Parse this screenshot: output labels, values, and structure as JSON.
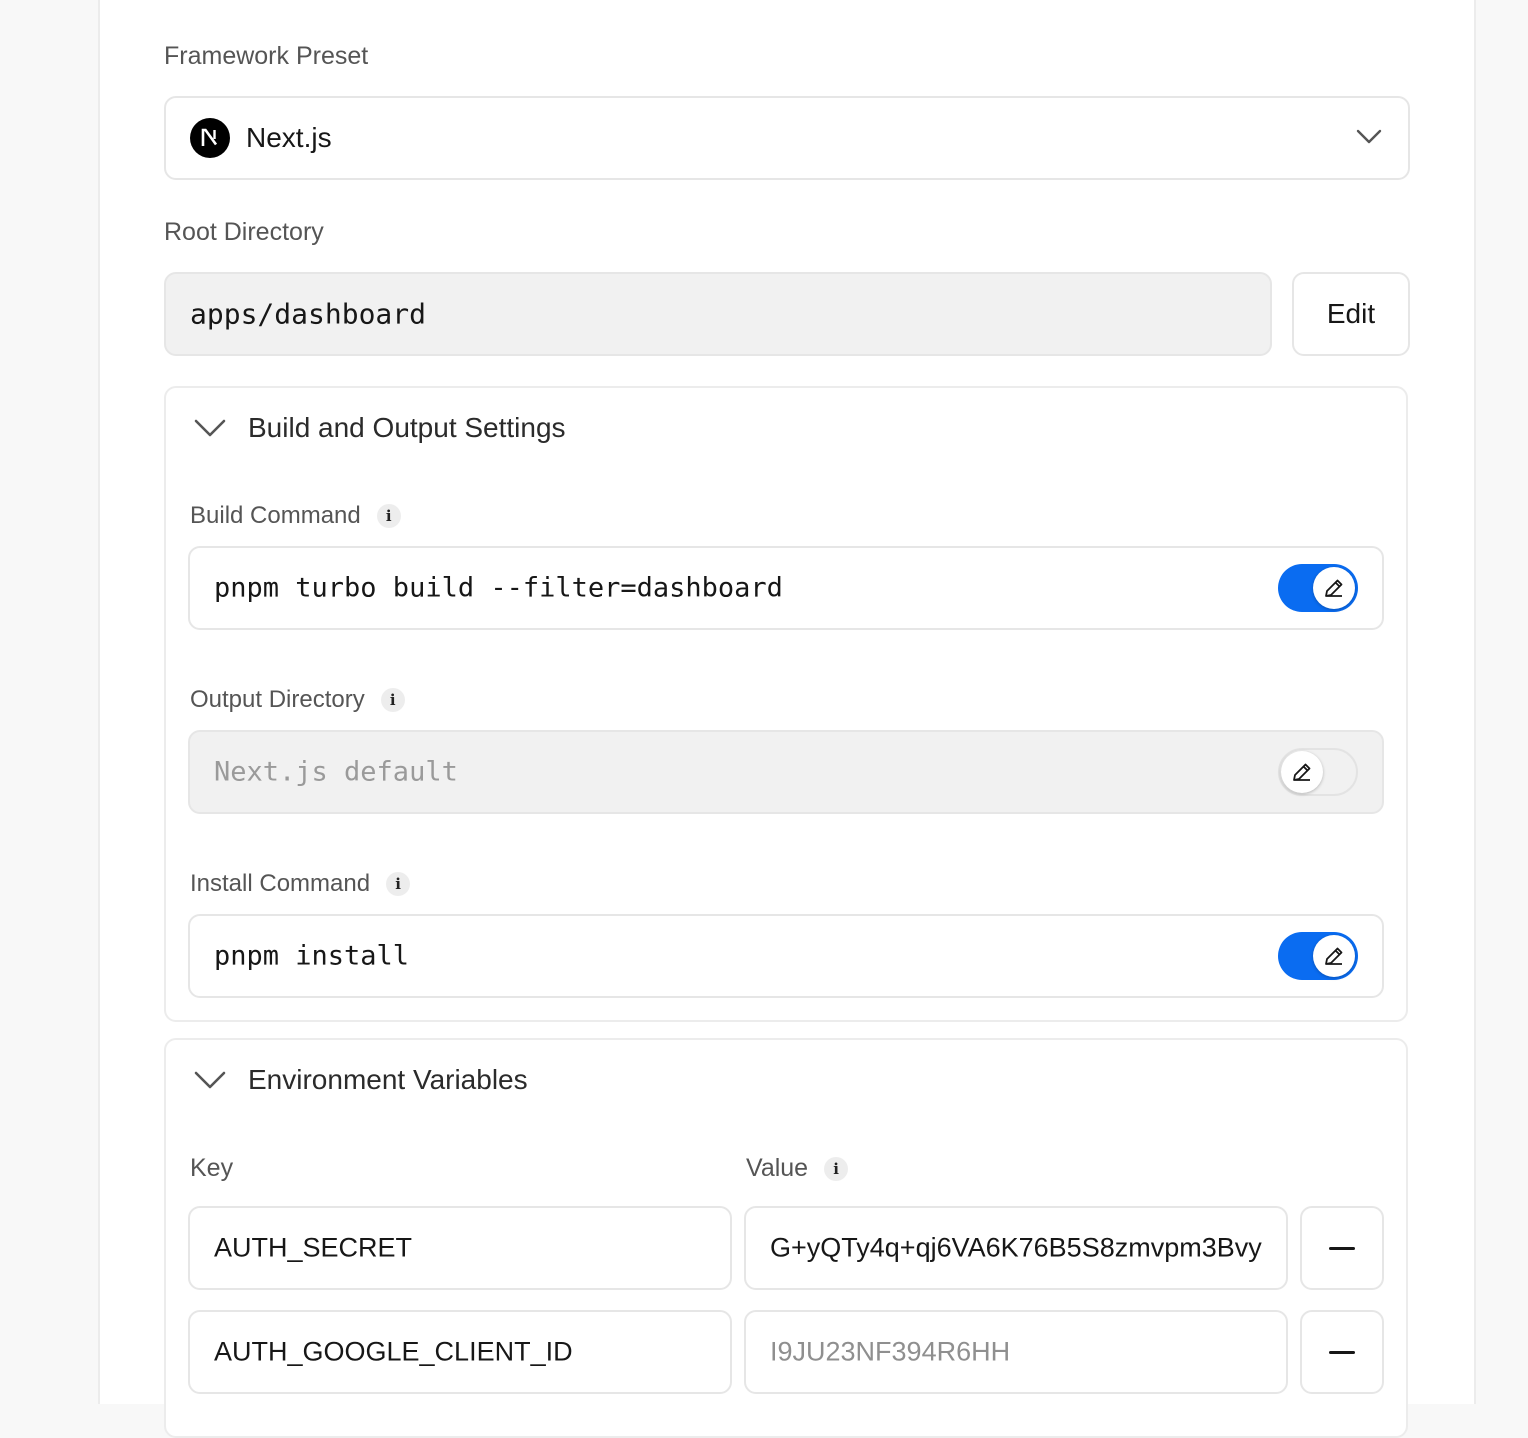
{
  "framework": {
    "label": "Framework Preset",
    "selected": "Next.js",
    "icon": "nextjs-logo-icon"
  },
  "root_directory": {
    "label": "Root Directory",
    "value": "apps/dashboard",
    "edit_label": "Edit"
  },
  "build_output": {
    "title": "Build and Output Settings",
    "build_command": {
      "label": "Build Command",
      "value": "pnpm turbo build --filter=dashboard",
      "override": true
    },
    "output_directory": {
      "label": "Output Directory",
      "placeholder": "Next.js default",
      "override": false
    },
    "install_command": {
      "label": "Install Command",
      "value": "pnpm install",
      "override": true
    }
  },
  "env": {
    "title": "Environment Variables",
    "key_header": "Key",
    "value_header": "Value",
    "rows": [
      {
        "key": "AUTH_SECRET",
        "value": "G+yQTy4q+qj6VA6K76B5S8zmvpm3Bvy"
      },
      {
        "key": "AUTH_GOOGLE_CLIENT_ID",
        "value": "I9JU23NF394R6HH"
      }
    ]
  },
  "colors": {
    "accent": "#0a6cf1",
    "muted_text": "#555555",
    "border": "#e6e6e6"
  }
}
